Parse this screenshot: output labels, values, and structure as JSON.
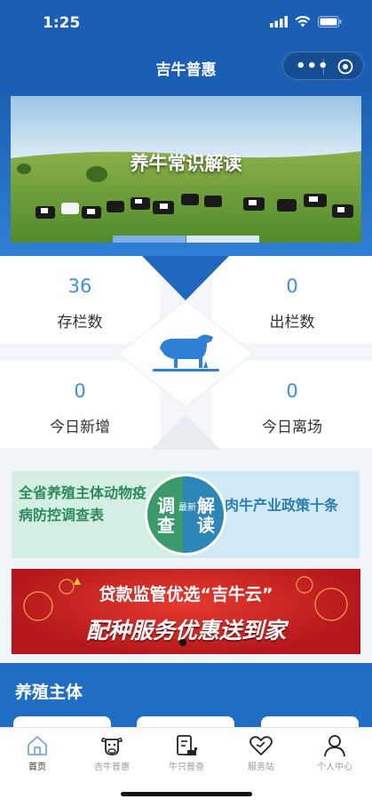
{
  "status": {
    "time": "1:25"
  },
  "nav": {
    "title": "吉牛普惠"
  },
  "banner": {
    "title": "养牛常识解读"
  },
  "stats": [
    {
      "value": "36",
      "label": "存栏数"
    },
    {
      "value": "0",
      "label": "出栏数"
    },
    {
      "value": "0",
      "label": "今日新增"
    },
    {
      "value": "0",
      "label": "今日离场"
    }
  ],
  "promo": {
    "left": "全省养殖主体动物疫病防控调查表",
    "right": "肉牛产业政策十条",
    "badge_left": "调查",
    "badge_small": "最新",
    "badge_right": "解读"
  },
  "ad": {
    "line1": "贷款监管优选“吉牛云”",
    "line2": "配种服务优惠送到家"
  },
  "section": {
    "title": "养殖主体"
  },
  "tabs": [
    {
      "label": "首页",
      "icon": "home-icon"
    },
    {
      "label": "吉牛普惠",
      "icon": "cow-icon"
    },
    {
      "label": "牛只普查",
      "icon": "survey-icon"
    },
    {
      "label": "服务站",
      "icon": "heart-icon"
    },
    {
      "label": "个人中心",
      "icon": "user-icon"
    }
  ],
  "colors": {
    "primary": "#1a5fb4",
    "accent": "#3d8ee0",
    "green": "#2e8a5a",
    "ad_red": "#c8201f"
  }
}
